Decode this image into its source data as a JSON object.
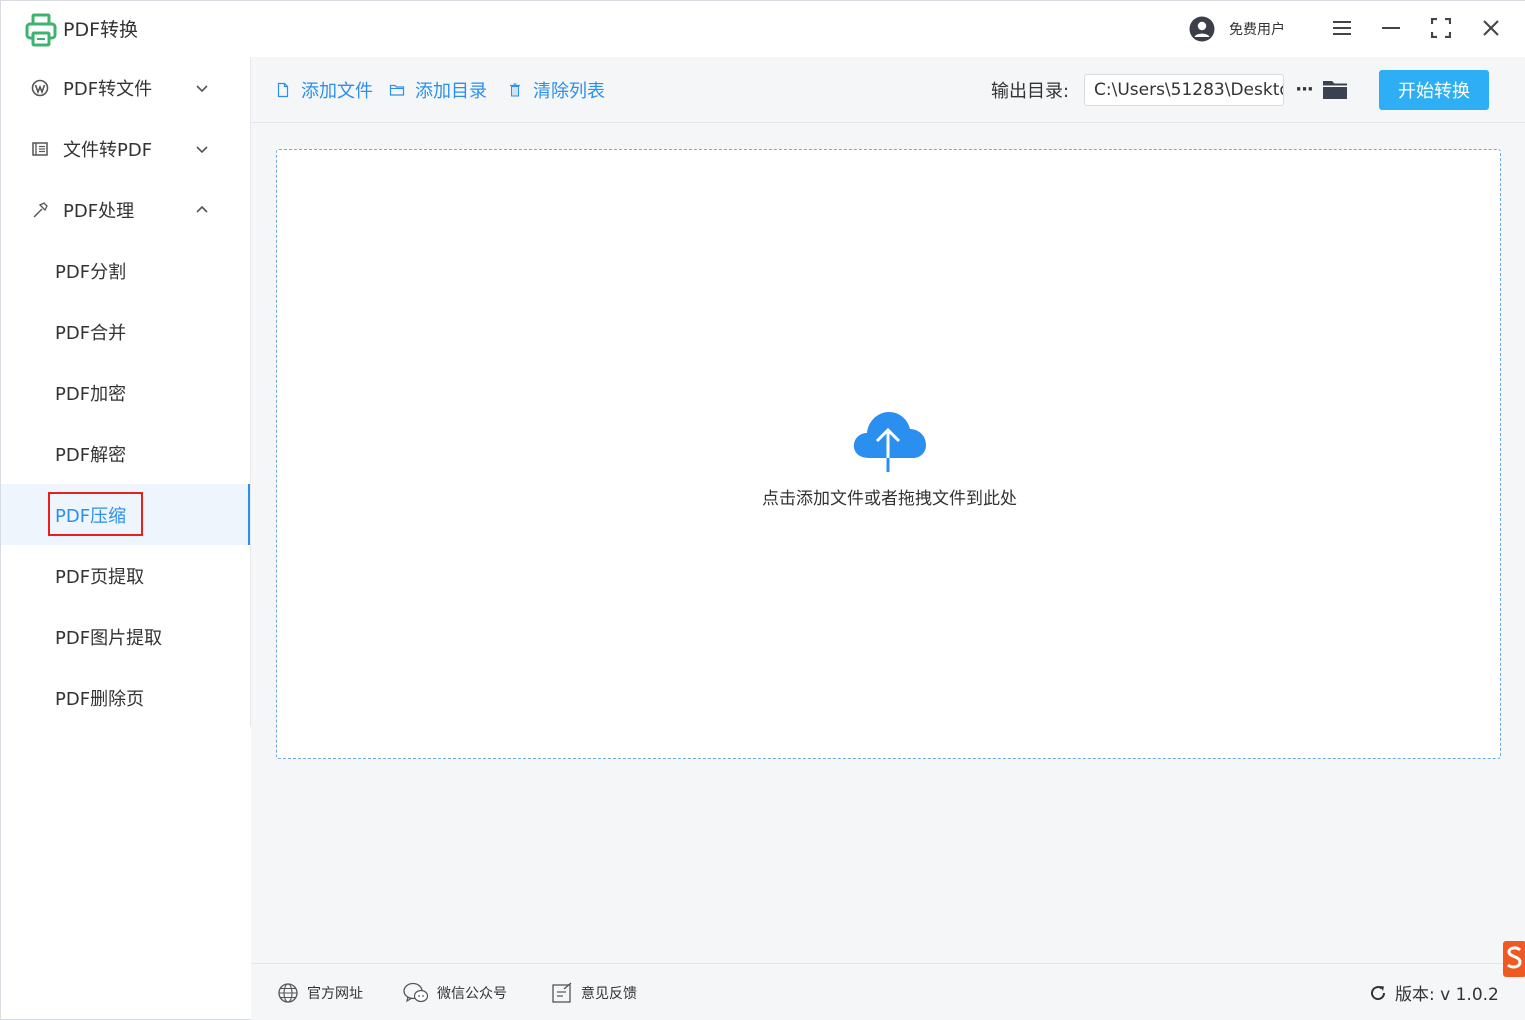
{
  "app": {
    "title": "PDF转换",
    "user_label": "免费用户"
  },
  "sidebar": {
    "groups": [
      {
        "label": "PDF转文件",
        "icon": "wordpress-icon",
        "expanded": false
      },
      {
        "label": "文件转PDF",
        "icon": "document-icon",
        "expanded": false
      },
      {
        "label": "PDF处理",
        "icon": "hammer-icon",
        "expanded": true
      }
    ],
    "items": [
      {
        "label": "PDF分割"
      },
      {
        "label": "PDF合并"
      },
      {
        "label": "PDF加密"
      },
      {
        "label": "PDF解密"
      },
      {
        "label": "PDF压缩",
        "active": true
      },
      {
        "label": "PDF页提取"
      },
      {
        "label": "PDF图片提取"
      },
      {
        "label": "PDF删除页"
      }
    ]
  },
  "toolbar": {
    "add_file": "添加文件",
    "add_folder": "添加目录",
    "clear_list": "清除列表",
    "output_label": "输出目录:",
    "output_path": "C:\\Users\\51283\\Deskto",
    "more_label": "···",
    "start_label": "开始转换"
  },
  "dropzone": {
    "text": "点击添加文件或者拖拽文件到此处"
  },
  "footer": {
    "website": "官方网址",
    "wechat": "微信公众号",
    "feedback": "意见反馈",
    "version_label": "版本:  v 1.0.2"
  },
  "colors": {
    "accent": "#2b8ff0",
    "start_button": "#2daef5",
    "highlight": "#e8201c",
    "logo": "#3cb371"
  }
}
